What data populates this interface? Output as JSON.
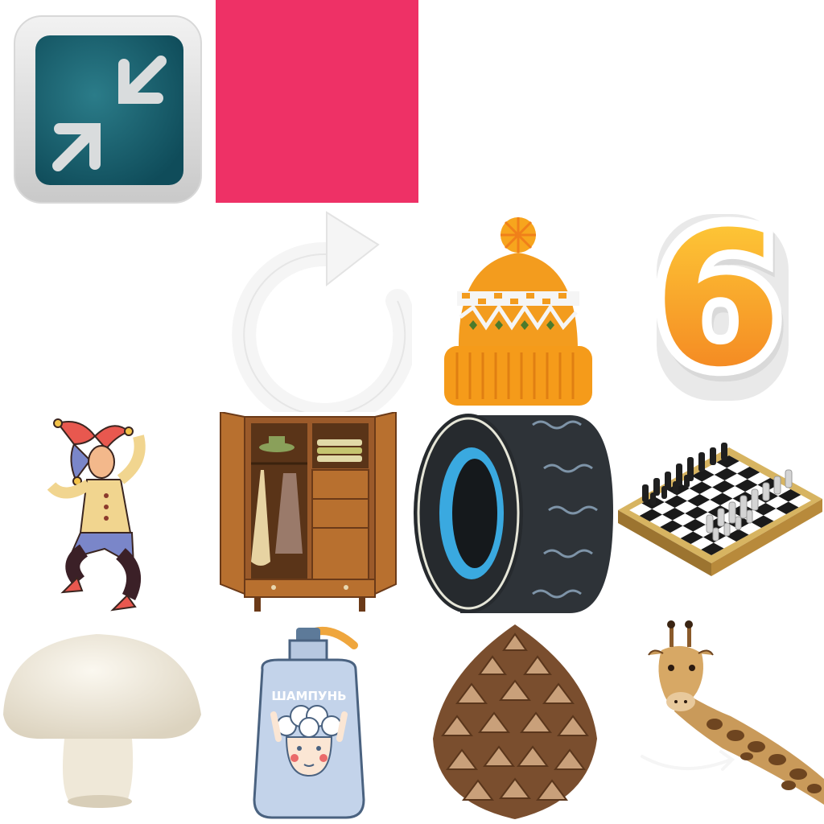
{
  "sprites": {
    "collapse_button": {
      "icon": "collapse-arrows-icon"
    },
    "color_swatch": {
      "color": "#EE3166"
    },
    "restart_arrow": {
      "icon": "restart-icon"
    },
    "winter_hat": {
      "icon": "knit-hat-icon"
    },
    "number_badge": {
      "value": "6"
    },
    "jester": {
      "icon": "jester-icon"
    },
    "wardrobe": {
      "icon": "wardrobe-icon"
    },
    "tire": {
      "icon": "tire-icon"
    },
    "chessboard": {
      "icon": "chessboard-icon"
    },
    "mushroom": {
      "icon": "mushroom-icon"
    },
    "shampoo": {
      "icon": "shampoo-bottle-icon",
      "label": "ШАМПУНЬ"
    },
    "pine_cone": {
      "icon": "pine-cone-icon"
    },
    "giraffe": {
      "icon": "giraffe-icon"
    }
  }
}
